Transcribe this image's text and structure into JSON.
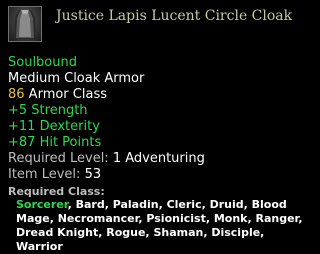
{
  "item": {
    "name": "Justice Lapis Lucent Circle Cloak",
    "icon": "cloak-icon",
    "binding": "Soulbound",
    "type": "Medium Cloak Armor",
    "armor_class_value": "86",
    "armor_class_label": " Armor Class",
    "stats": [
      "+5 Strength",
      "+11 Dexterity",
      "+87 Hit Points"
    ],
    "required_level_label": "Required Level: ",
    "required_level_value": "1 Adventuring",
    "item_level_label": "Item Level: ",
    "item_level_value": "53",
    "required_class_label": "Required Class:",
    "classes_highlight": "Sorcerer",
    "classes_rest": ", Bard, Paladin, Cleric, Druid, Blood Mage, Necromancer, Psionicist, Monk, Ranger, Dread Knight, Rogue, Shaman, Disciple, Warrior"
  },
  "colors": {
    "title": "#c9c9a0",
    "green": "#2ed84f",
    "gold": "#e8c23a",
    "gray": "#bdbdbd",
    "white": "#ffffff",
    "background": "#000000"
  }
}
